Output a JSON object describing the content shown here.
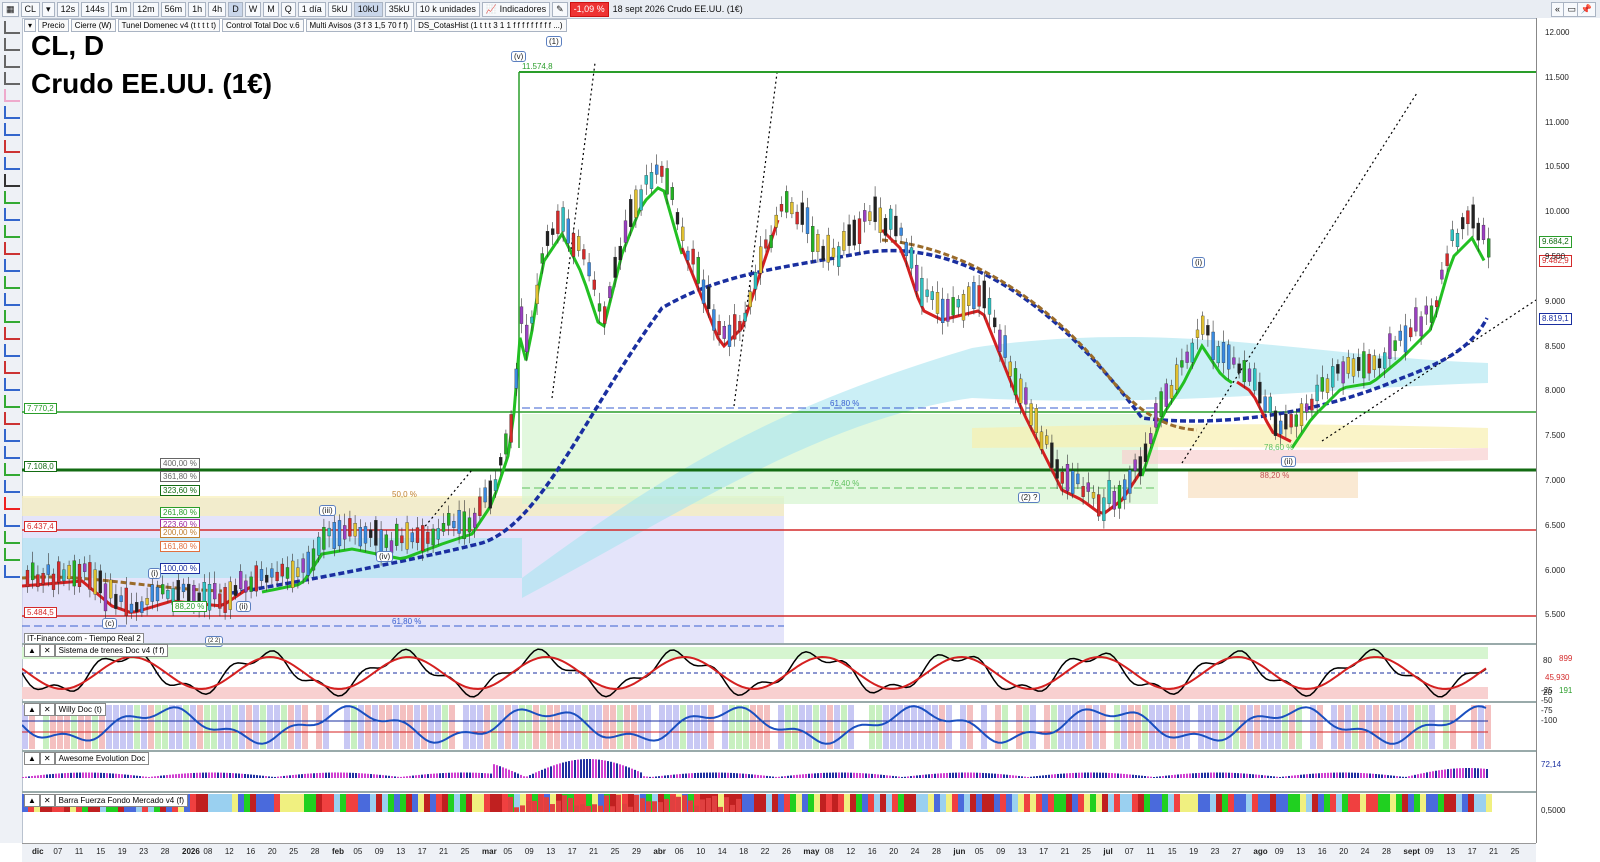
{
  "toolbar": {
    "symbol": "CL",
    "timeframes": [
      "12s",
      "144s",
      "1m",
      "12m",
      "56m",
      "1h",
      "4h",
      "D",
      "W",
      "M",
      "Q"
    ],
    "period": "1 día",
    "units": [
      "5kU",
      "10kU",
      "35kU"
    ],
    "units_selected": "10kU",
    "unit_count": "10 k unidades",
    "indicators_label": "Indicadores",
    "change_badge": "-1,09 %",
    "header_text": "18 sept 2026 Crudo EE.UU. (1€)"
  },
  "indicator_tabs": [
    "Precio",
    "Cierre (W)",
    "Tunel Domenec v4 (t t t t t)",
    "Control Total Doc v.6",
    "Multi Avisos (3 f 3 1,5 70 f f)",
    "DS_CotasHist (1 t t t 3 1 1 f f f f f f f f f ...)"
  ],
  "chart": {
    "title_line1": "CL, D",
    "title_line2": "Crudo EE.UU. (1€)",
    "source_label": "IT-Finance.com - Tiempo Real 2",
    "level_labels": {
      "top": "11.574,8",
      "l7770": "7.770,2",
      "l7108": "7.108,0",
      "l6437": "6.437,4",
      "l5484": "5.484,5"
    },
    "fib_labels": [
      "400,00 %",
      "361,80 %",
      "323,60 %",
      "261,80 %",
      "223,60 %",
      "200,00 %",
      "161,80 %",
      "100,00 %",
      "88,20 %"
    ],
    "mid_labels": {
      "fib618_a": "61,80 %",
      "fib618_b": "61,80 %",
      "fib764": "76,40 %",
      "fib882": "88,20 %",
      "fib786": "78,60 %",
      "fib500": "50,0 %"
    },
    "waves": {
      "w1": "(1)",
      "wv": "(v)",
      "wi": "(i)",
      "wii": "(ii)",
      "wiii": "(iii)",
      "wiv": "(iv)",
      "wc": "(c)",
      "w2q": "(2) ?",
      "wi2": "(i)",
      "wii2": "(ii)",
      "wii3": "(ii)",
      "w2b": "(2 2)"
    }
  },
  "price_axis": {
    "ticks": [
      "12.000",
      "11.500",
      "11.000",
      "10.500",
      "10.000",
      "9.500",
      "9.000",
      "8.500",
      "8.000",
      "7.500",
      "7.000",
      "6.500",
      "6.000",
      "5.500"
    ],
    "last_price": "9.684,2",
    "red_price": "9.482,9",
    "blue_price": "8.819,1"
  },
  "panes": {
    "trenes": {
      "name": "Sistema de trenes Doc v4 (f f)",
      "ticks": [
        "80",
        "899",
        "45,930",
        "20"
      ]
    },
    "willy": {
      "name": "Willy Doc (t)",
      "ticks": [
        "-25",
        "-50",
        "-75",
        "-100",
        "191"
      ]
    },
    "awesome": {
      "name": "Awesome Evolution Doc",
      "ticks": [
        "72,14"
      ]
    },
    "barra": {
      "name": "Barra Fuerza Fondo Mercado v4 (f)",
      "ticks": [
        "0,5000"
      ]
    }
  },
  "date_axis": [
    "dic",
    "07",
    "11",
    "15",
    "19",
    "23",
    "28",
    "2026",
    "08",
    "12",
    "16",
    "20",
    "25",
    "28",
    "feb",
    "05",
    "09",
    "13",
    "17",
    "21",
    "25",
    "mar",
    "05",
    "09",
    "13",
    "17",
    "21",
    "25",
    "29",
    "abr",
    "06",
    "10",
    "14",
    "18",
    "22",
    "26",
    "may",
    "08",
    "12",
    "16",
    "20",
    "24",
    "28",
    "jun",
    "05",
    "09",
    "13",
    "17",
    "21",
    "25",
    "jul",
    "07",
    "11",
    "15",
    "19",
    "23",
    "27",
    "ago",
    "09",
    "13",
    "16",
    "20",
    "24",
    "28",
    "sept",
    "09",
    "13",
    "17",
    "21",
    "25"
  ],
  "colors": {
    "green_level": "#2a9d2a",
    "red_level": "#d42a2a",
    "blue_dash": "#1a2fa0",
    "brown_dash": "#9a6b2a",
    "bull_line": "#22c022",
    "bear_line": "#d42020"
  }
}
